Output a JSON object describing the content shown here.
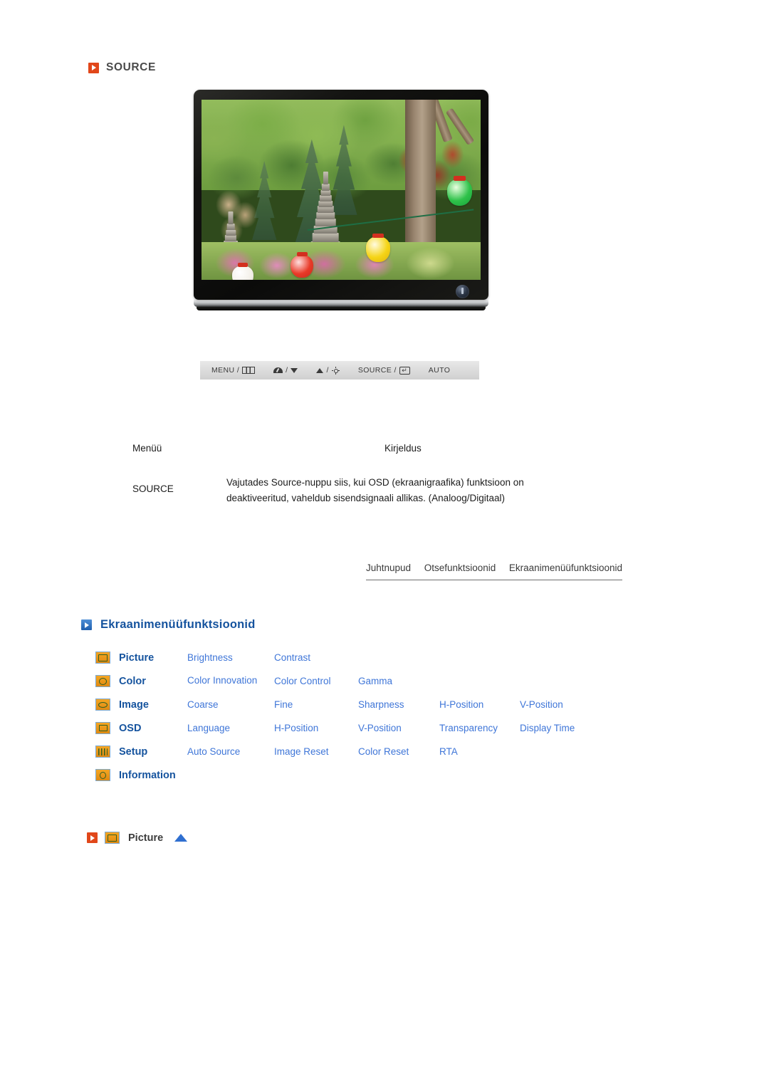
{
  "source_section": {
    "heading": "SOURCE",
    "bullet_icon": "play-square-icon",
    "bullet_color": "#e1471a"
  },
  "monitor": {
    "screen_content": "korean-garden-photo",
    "power_button_icon": "power-icon"
  },
  "control_strip": {
    "buttons": [
      {
        "label": "MENU /",
        "icon": "menu-panel-icon"
      },
      {
        "label": "/",
        "icon": "gauge-icon",
        "icon2": "triangle-down-icon"
      },
      {
        "label": "/",
        "icon": "triangle-up-icon",
        "icon2": "sun-brightness-icon"
      },
      {
        "label": "SOURCE /",
        "icon": "enter-key-icon"
      },
      {
        "label": "AUTO",
        "icon": "none"
      }
    ],
    "menu_label": "MENU /",
    "source_label": "SOURCE /",
    "auto_label": "AUTO",
    "slash": "/",
    "enter_glyph": "↵"
  },
  "description_table": {
    "header": {
      "menu": "Menüü",
      "description": "Kirjeldus"
    },
    "rows": [
      {
        "menu": "SOURCE",
        "description": "Vajutades Source-nuppu siis, kui OSD (ekraanigraafika) funktsioon on deaktiveeritud, vaheldub sisendsignaali allikas. (Analoog/Digitaal)"
      }
    ]
  },
  "tab_nav": {
    "tabs": [
      {
        "label": "Juhtnupud"
      },
      {
        "label": "Otsefunktsioonid"
      },
      {
        "label": "Ekraanimenüüfunktsioonid"
      }
    ]
  },
  "osd_section": {
    "heading": "Ekraanimenüüfunktsioonid",
    "bullet_icon": "play-square-icon",
    "bullet_color": "#1f5fae",
    "rows": [
      {
        "category": "Picture",
        "icon": "picture-icon",
        "items": [
          "Brightness",
          "Contrast",
          "",
          "",
          ""
        ]
      },
      {
        "category": "Color",
        "icon": "color-icon",
        "items": [
          "Color Innovation",
          "Color Control",
          "Gamma",
          "",
          ""
        ]
      },
      {
        "category": "Image",
        "icon": "image-icon",
        "items": [
          "Coarse",
          "Fine",
          "Sharpness",
          "H-Position",
          "V-Position"
        ]
      },
      {
        "category": "OSD",
        "icon": "osd-icon",
        "items": [
          "Language",
          "H-Position",
          "V-Position",
          "Transparency",
          "Display Time"
        ]
      },
      {
        "category": "Setup",
        "icon": "setup-icon",
        "items": [
          "Auto Source",
          "Image Reset",
          "Color Reset",
          "RTA",
          ""
        ]
      },
      {
        "category": "Information",
        "icon": "information-icon",
        "items": [
          "",
          "",
          "",
          "",
          ""
        ]
      }
    ]
  },
  "picture_anchor": {
    "bullet_icon": "play-square-icon",
    "category_icon": "picture-icon",
    "label": "Picture",
    "top_arrow_icon": "triangle-up-icon"
  }
}
